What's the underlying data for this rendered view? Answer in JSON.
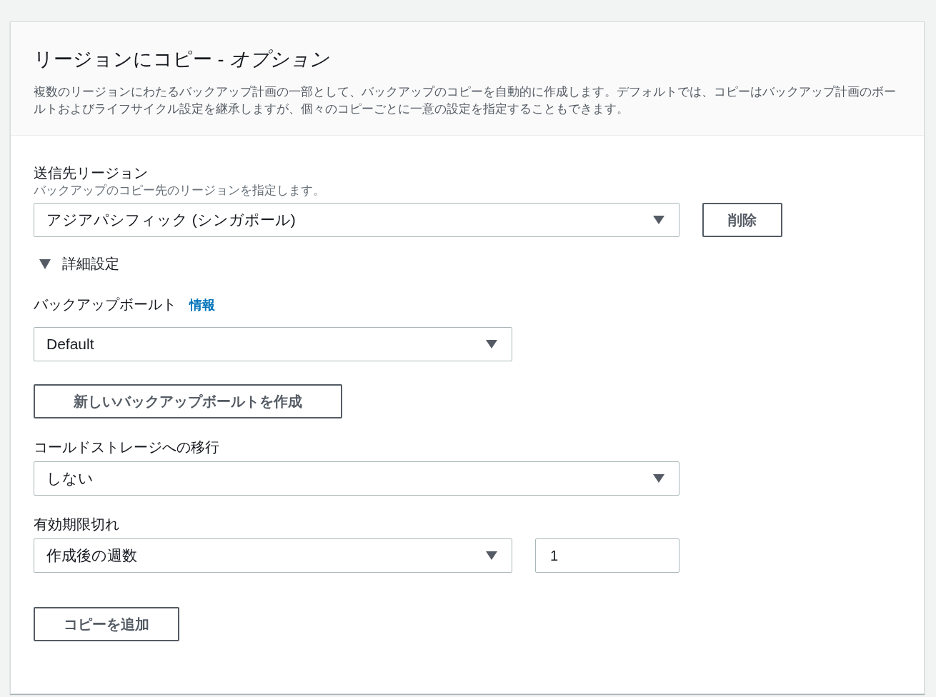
{
  "panel": {
    "title": "リージョンにコピー - *オプション*",
    "description": "複数のリージョンにわたるバックアップ計画の一部として、バックアップのコピーを自動的に作成します。デフォルトでは、コピーはバックアップ計画のボールトおよびライフサイクル設定を継承しますが、個々のコピーごとに一意の設定を指定することもできます。"
  },
  "destination": {
    "label": "送信先リージョン",
    "hint": "バックアップのコピー先のリージョンを指定します。",
    "value": "アジアパシフィック (シンガポール)",
    "remove_button": "削除"
  },
  "advanced": {
    "label": "詳細設定",
    "expanded": true
  },
  "vault": {
    "label": "バックアップボールト",
    "info_link": "情報",
    "value": "Default",
    "create_button": "新しいバックアップボールトを作成"
  },
  "cold_storage": {
    "label": "コールドストレージへの移行",
    "value": "しない"
  },
  "expiration": {
    "label": "有効期限切れ",
    "value": "作成後の週数",
    "amount": "1"
  },
  "add_copy_button": "コピーを追加"
}
